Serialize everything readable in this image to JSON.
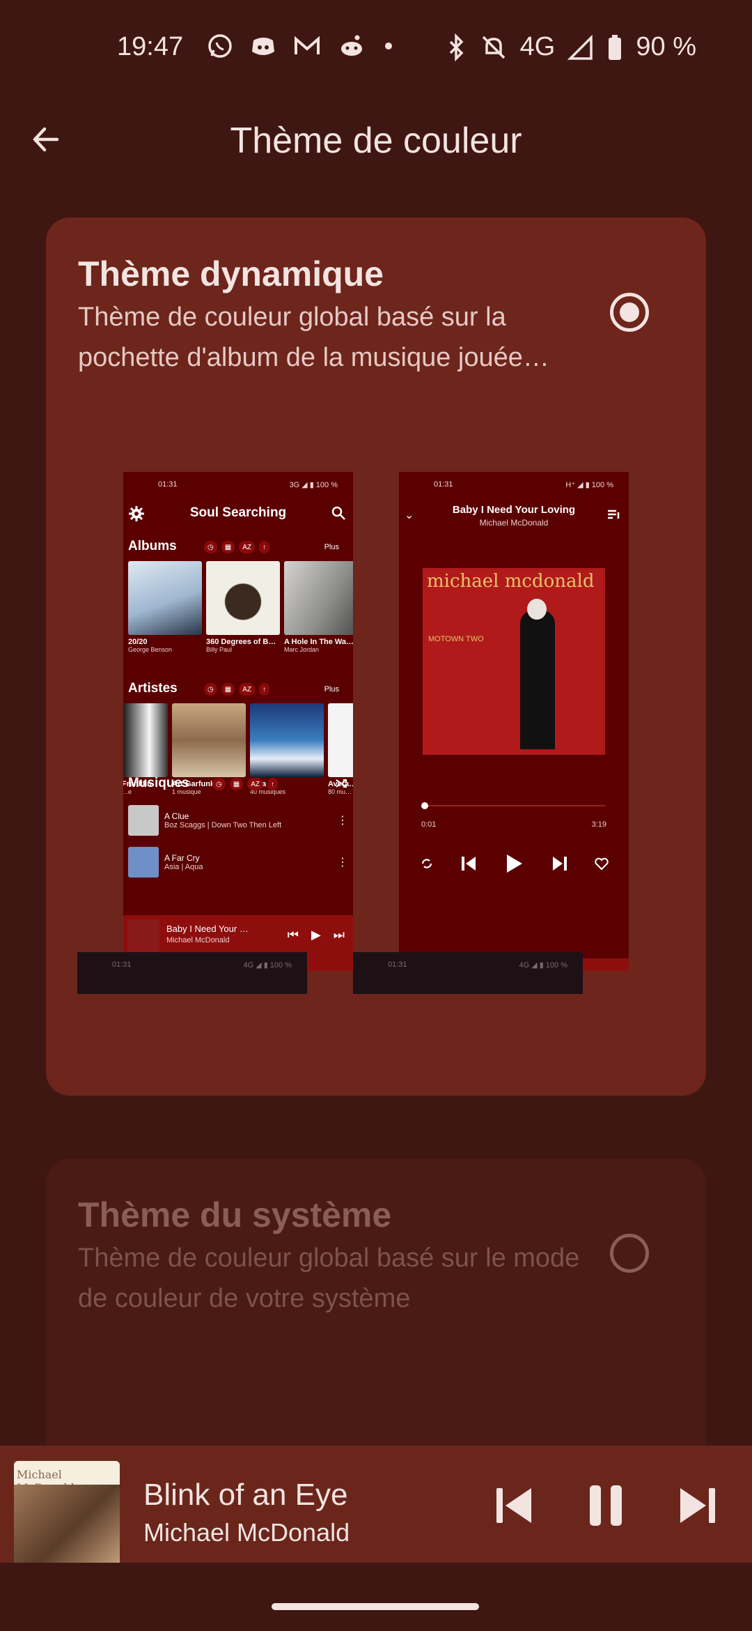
{
  "status_bar": {
    "time": "19:47",
    "network": "4G",
    "battery": "90 %",
    "icons": [
      "whatsapp-icon",
      "discord-icon",
      "gmail-icon",
      "reddit-icon",
      "dot-icon",
      "bluetooth-icon",
      "mute-icon",
      "signal-icon",
      "battery-icon"
    ]
  },
  "header": {
    "title": "Thème de couleur"
  },
  "options": [
    {
      "title": "Thème dynamique",
      "description": "Thème de couleur global basé sur la pochette d'album de la musique jouée…",
      "selected": true
    },
    {
      "title": "Thème du système",
      "description": "Thème de couleur global basé sur le mode de couleur de votre système",
      "selected": false
    }
  ],
  "preview_library": {
    "status_time": "01:31",
    "status_right": "3G ◢ ▮ 100 %",
    "app_title": "Soul Searching",
    "sort_labels": [
      "◷",
      "▦",
      "AZ",
      "↑"
    ],
    "more_label": "Plus",
    "albums_label": "Albums",
    "albums": [
      {
        "title": "20/20",
        "artist": "George Benson"
      },
      {
        "title": "360 Degrees of B…",
        "artist": "Billy Paul"
      },
      {
        "title": "A Hole In The Wa…",
        "artist": "Marc Jordan"
      }
    ],
    "artists_label": "Artistes",
    "artists": [
      {
        "name": "Franklin",
        "count": "…e"
      },
      {
        "name": "Art Garfunkel",
        "count": "1 musique"
      },
      {
        "name": "Asia",
        "count": "40 musiques"
      },
      {
        "name": "Avera…",
        "count": "80 mu…"
      }
    ],
    "songs_label": "Musiques",
    "songs": [
      {
        "title": "A Clue",
        "subtitle": "Boz Scaggs | Down Two Then Left"
      },
      {
        "title": "A Far Cry",
        "subtitle": "Asia | Aqua"
      }
    ],
    "mini_title": "Baby I Need Your …",
    "mini_artist": "Michael McDonald"
  },
  "preview_player": {
    "status_time": "01:31",
    "status_right": "H⁺ ◢ ▮ 100 %",
    "title": "Baby I Need Your Loving",
    "artist": "Michael McDonald",
    "cover_text": "michael mcdonald",
    "cover_subtext": "MOTOWN TWO",
    "time_elapsed": "0:01",
    "time_total": "3:19"
  },
  "preview_system": {
    "status_time": "01:31",
    "status_right": "4G ◢ ▮ 100 %"
  },
  "mini_player": {
    "title": "Blink of an Eye",
    "artist": "Michael McDonald",
    "art_text": "Michael McDonald"
  }
}
